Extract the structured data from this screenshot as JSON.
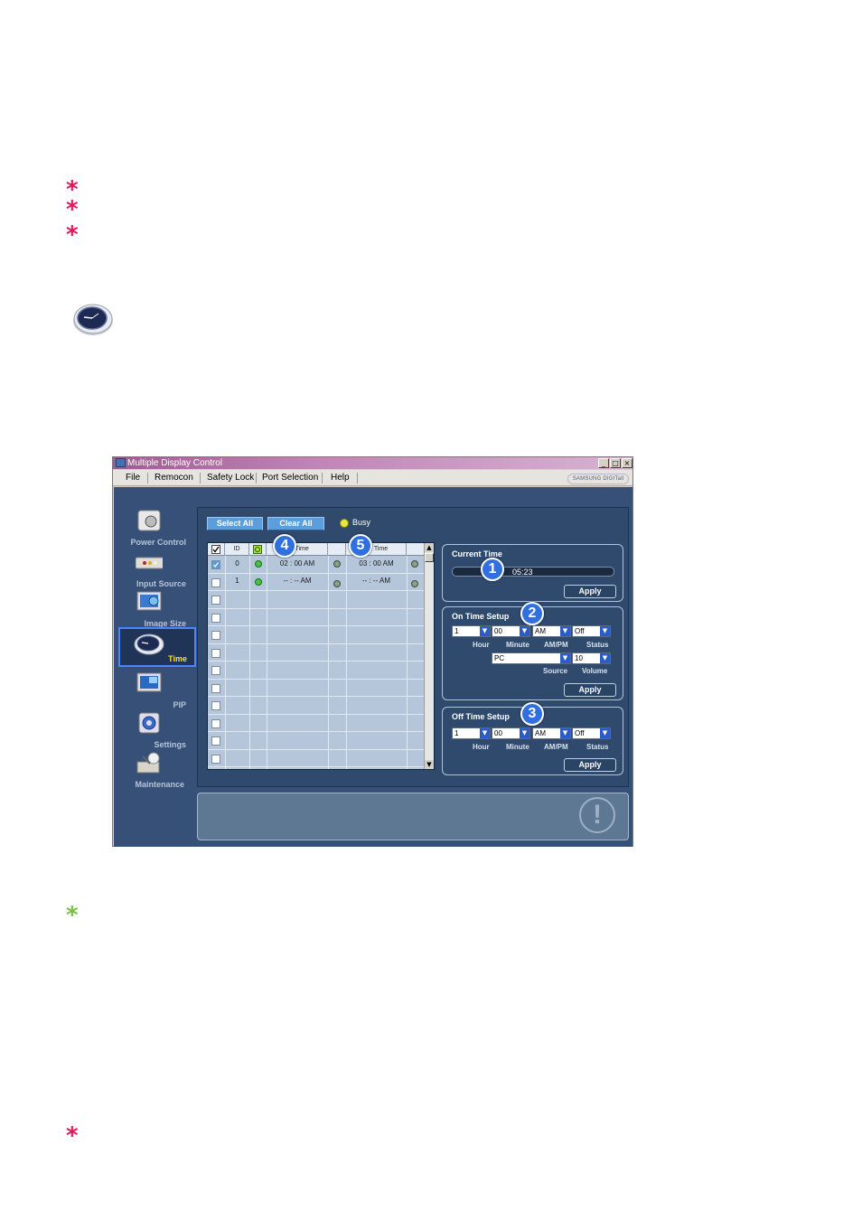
{
  "window": {
    "title": "Multiple Display Control",
    "brand": "SAMSUNG DIGITall",
    "controls": {
      "minimize": "_",
      "maximize": "□",
      "close": "×"
    }
  },
  "menu": [
    "File",
    "Remocon",
    "Safety Lock",
    "Port Selection",
    "Help"
  ],
  "sidebar": {
    "items": [
      {
        "label": "Power Control",
        "icon": "power-control-icon"
      },
      {
        "label": "Input Source",
        "icon": "input-source-icon"
      },
      {
        "label": "Image Size",
        "icon": "image-size-icon"
      },
      {
        "label": "Time",
        "icon": "clock-icon",
        "active": true
      },
      {
        "label": "PIP",
        "icon": "pip-icon"
      },
      {
        "label": "Settings",
        "icon": "settings-icon"
      },
      {
        "label": "Maintenance",
        "icon": "maintenance-icon"
      }
    ]
  },
  "toolbar": {
    "select_all": "Select All",
    "clear_all": "Clear All",
    "busy_label": "Busy"
  },
  "grid": {
    "headers": {
      "id": "ID",
      "on_time": "On Time",
      "off_time": "Off Time"
    },
    "rows": [
      {
        "checked": true,
        "id": "0",
        "on_time": "02 : 00 AM",
        "off_time": "03 : 00 AM"
      },
      {
        "checked": false,
        "id": "1",
        "on_time": "-- : -- AM",
        "off_time": "-- : -- AM"
      }
    ]
  },
  "badges": [
    "1",
    "2",
    "3",
    "4",
    "5"
  ],
  "current_time": {
    "title": "Current Time",
    "value": "05:23",
    "apply": "Apply"
  },
  "on_time_setup": {
    "title": "On Time Setup",
    "hour": "1",
    "minute": "00",
    "ampm": "AM",
    "status": "Off",
    "source": "PC",
    "volume": "10",
    "labels": {
      "hour": "Hour",
      "minute": "Minute",
      "ampm": "AM/PM",
      "status": "Status",
      "source": "Source",
      "volume": "Volume"
    },
    "apply": "Apply"
  },
  "off_time_setup": {
    "title": "Off Time Setup",
    "hour": "1",
    "minute": "00",
    "ampm": "AM",
    "status": "Off",
    "labels": {
      "hour": "Hour",
      "minute": "Minute",
      "ampm": "AM/PM",
      "status": "Status"
    },
    "apply": "Apply"
  },
  "notes": {
    "asterisk": "*"
  },
  "colors": {
    "pink_asterisk": "#e0195a",
    "green_asterisk": "#77c043",
    "panel_bg": "#365078",
    "button_blue": "#5c9edc"
  }
}
